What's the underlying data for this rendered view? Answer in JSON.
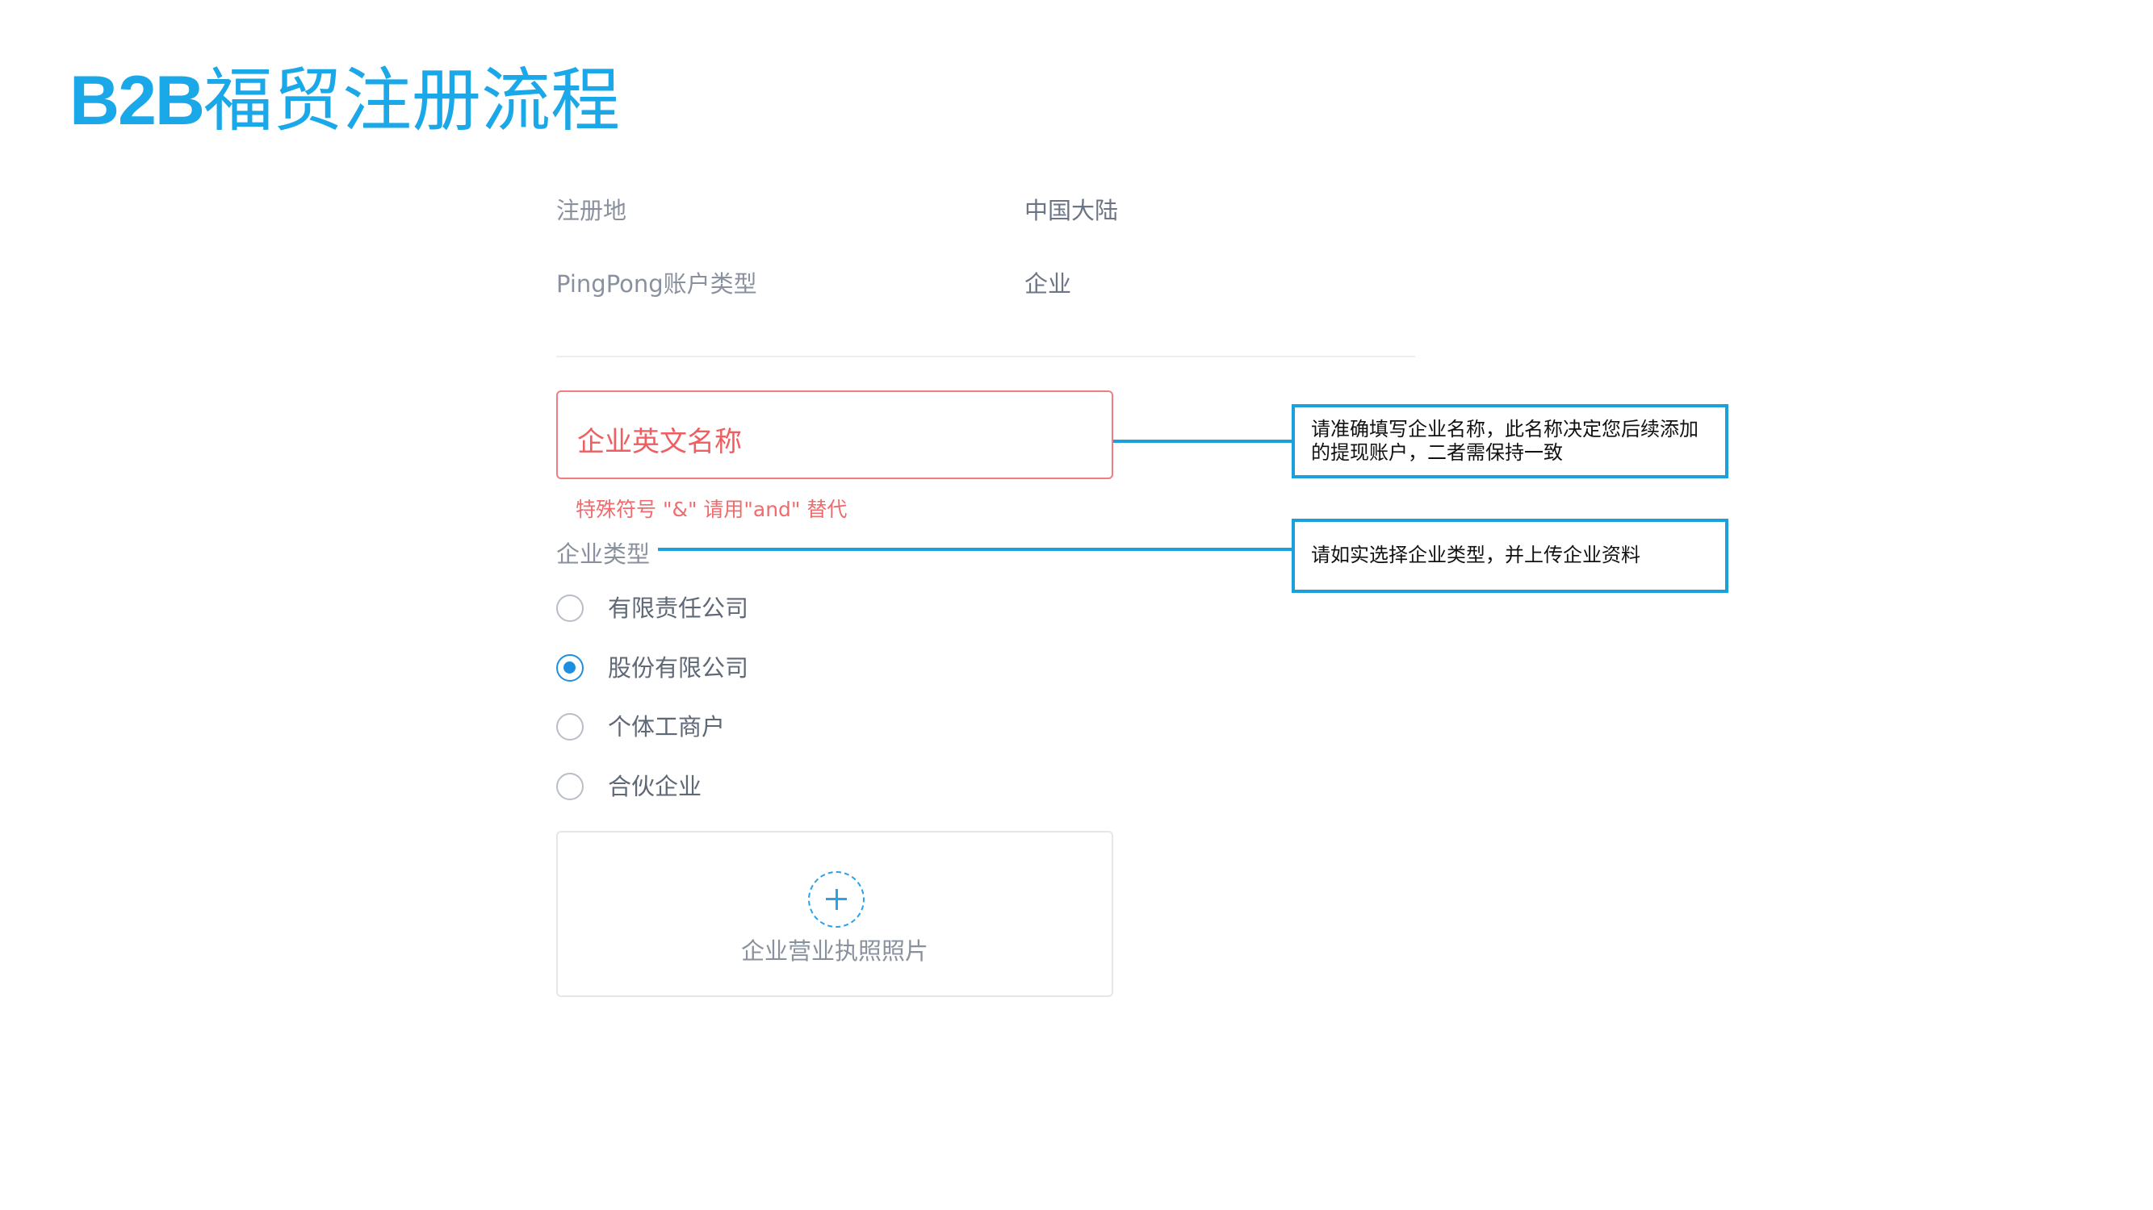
{
  "slide_title": {
    "bold_part": "B2B",
    "rest": "福贸注册流程"
  },
  "info_rows": [
    {
      "label": "注册地",
      "value": "中国大陆"
    },
    {
      "label": "PingPong账户类型",
      "value": "企业"
    }
  ],
  "company_name_field": {
    "label": "企业英文名称",
    "hint": "特殊符号 \"&\" 请用\"and\" 替代"
  },
  "company_type": {
    "label": "企业类型",
    "options": [
      {
        "label": "有限责任公司",
        "selected": false
      },
      {
        "label": "股份有限公司",
        "selected": true
      },
      {
        "label": "个体工商户",
        "selected": false
      },
      {
        "label": "合伙企业",
        "selected": false
      }
    ]
  },
  "upload": {
    "label": "企业营业执照照片",
    "icon": "plus-icon"
  },
  "callouts": [
    {
      "text": "请准确填写企业名称，此名称决定您后续添加的提现账户，二者需保持一致"
    },
    {
      "text": "请如实选择企业类型，并上传企业资料"
    }
  ],
  "colors": {
    "title": "#1ba8e8",
    "error": "#ef5e60",
    "accent": "#1e8fe0",
    "callout_border": "#1ba0dc"
  }
}
